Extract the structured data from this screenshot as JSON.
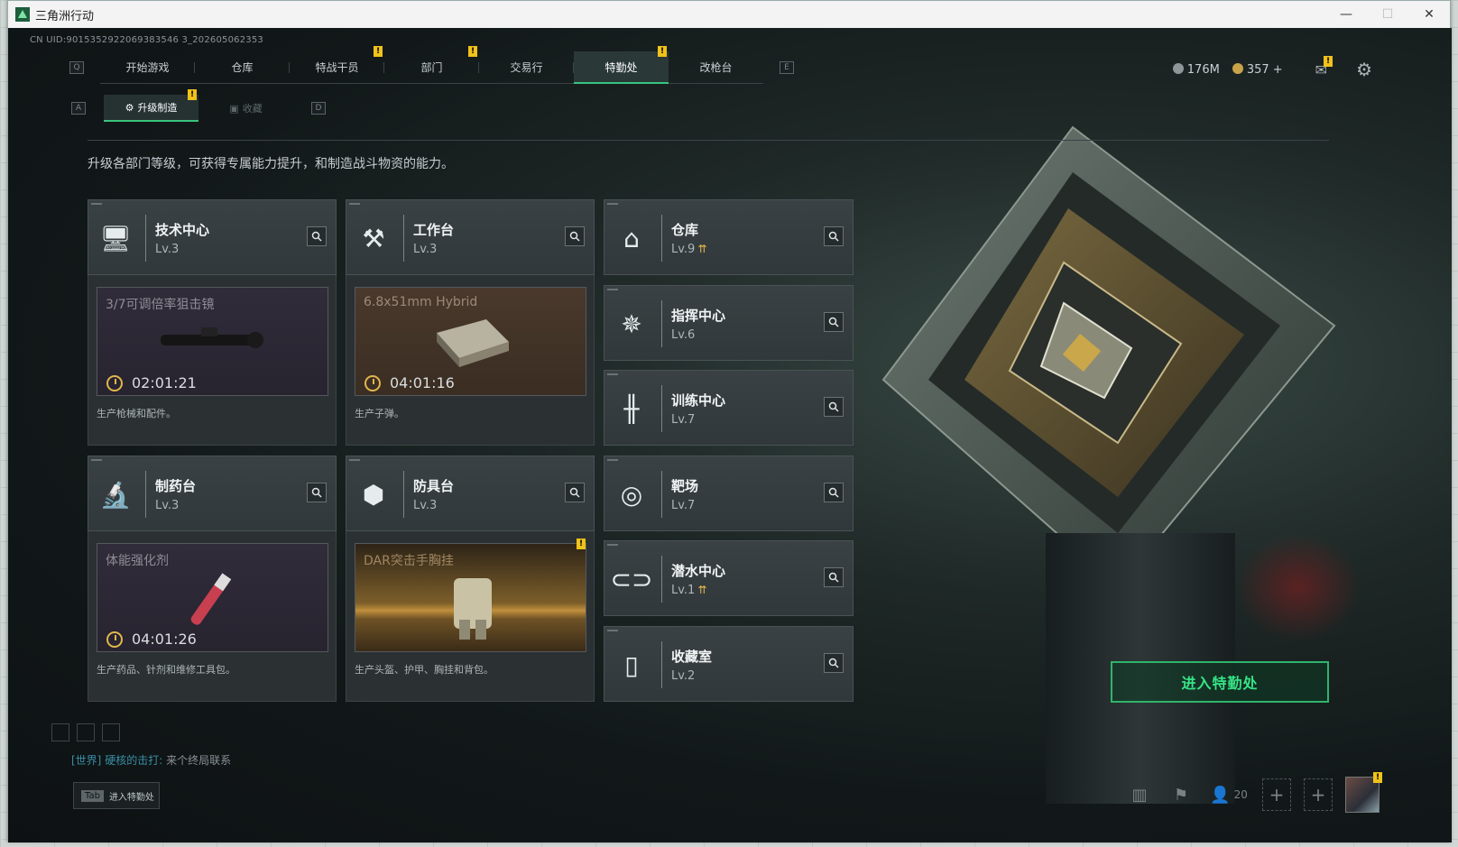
{
  "window": {
    "title": "三角洲行动",
    "controls": [
      "—",
      "☐",
      "✕"
    ]
  },
  "uid": "CN UID:9015352922069383546 3_202605062353",
  "nav": {
    "left_key": "Q",
    "right_key": "E",
    "tabs": [
      {
        "label": "开始游戏",
        "badge": ""
      },
      {
        "label": "仓库",
        "badge": ""
      },
      {
        "label": "特战干员",
        "badge": "!"
      },
      {
        "label": "部门",
        "badge": "!"
      },
      {
        "label": "交易行",
        "badge": ""
      },
      {
        "label": "特勤处",
        "badge": "!",
        "active": true
      },
      {
        "label": "改枪台",
        "badge": ""
      }
    ]
  },
  "subnav": {
    "left_key": "A",
    "right_key": "D",
    "tabs": [
      {
        "label": "升级制造",
        "badge": "!"
      },
      {
        "label": "收藏",
        "badge": ""
      }
    ]
  },
  "hud": {
    "currency1": "176M",
    "currency2": "357 +",
    "mail_badge": "!"
  },
  "intro": "升级各部门等级，可获得专属能力提升，和制造战斗物资的能力。",
  "departments": {
    "tech": {
      "name": "技术中心",
      "lv": "Lv.3",
      "icon": "monitor-icon"
    },
    "workbench": {
      "name": "工作台",
      "lv": "Lv.3",
      "icon": "tools-icon"
    },
    "warehouse": {
      "name": "仓库",
      "lv": "Lv.9",
      "icon": "warehouse-icon"
    },
    "command": {
      "name": "指挥中心",
      "lv": "Lv.6",
      "icon": "command-icon"
    },
    "training": {
      "name": "训练中心",
      "lv": "Lv.7",
      "icon": "dumbbell-icon"
    },
    "pharmacy": {
      "name": "制药台",
      "lv": "Lv.3",
      "icon": "microscope-icon"
    },
    "armor": {
      "name": "防具台",
      "lv": "Lv.3",
      "icon": "armor-icon"
    },
    "range": {
      "name": "靶场",
      "lv": "Lv.7",
      "icon": "target-icon"
    },
    "diving": {
      "name": "潜水中心",
      "lv": "Lv.1",
      "icon": "goggles-icon"
    },
    "collection": {
      "name": "收藏室",
      "lv": "Lv.2",
      "icon": "vault-icon"
    }
  },
  "production": {
    "tech": {
      "item": "3/7可调倍率狙击镜",
      "timer": "02:01:21",
      "desc": "生产枪械和配件。"
    },
    "workbench": {
      "item": "6.8x51mm Hybrid",
      "timer": "04:01:16",
      "desc": "生产子弹。"
    },
    "pharmacy": {
      "item": "体能强化剂",
      "timer": "04:01:26",
      "desc": "生产药品、针剂和维修工具包。"
    },
    "armor": {
      "item": "DAR突击手胸挂",
      "timer": "",
      "badge": "!",
      "desc": "生产头盔、护甲、胸挂和背包。"
    }
  },
  "enter_button": "进入特勤处",
  "chat": {
    "channel": "[世界]",
    "user": "硬核的击打:",
    "message": "来个终局联系"
  },
  "tab_hint": {
    "key": "Tab",
    "label": "进入特勤处"
  },
  "bottom": {
    "friends": "20",
    "avatar_badge": "!"
  },
  "colors": {
    "accent": "#37c47e",
    "badge": "#f0c21a",
    "upgrade": "#e8b84a"
  }
}
